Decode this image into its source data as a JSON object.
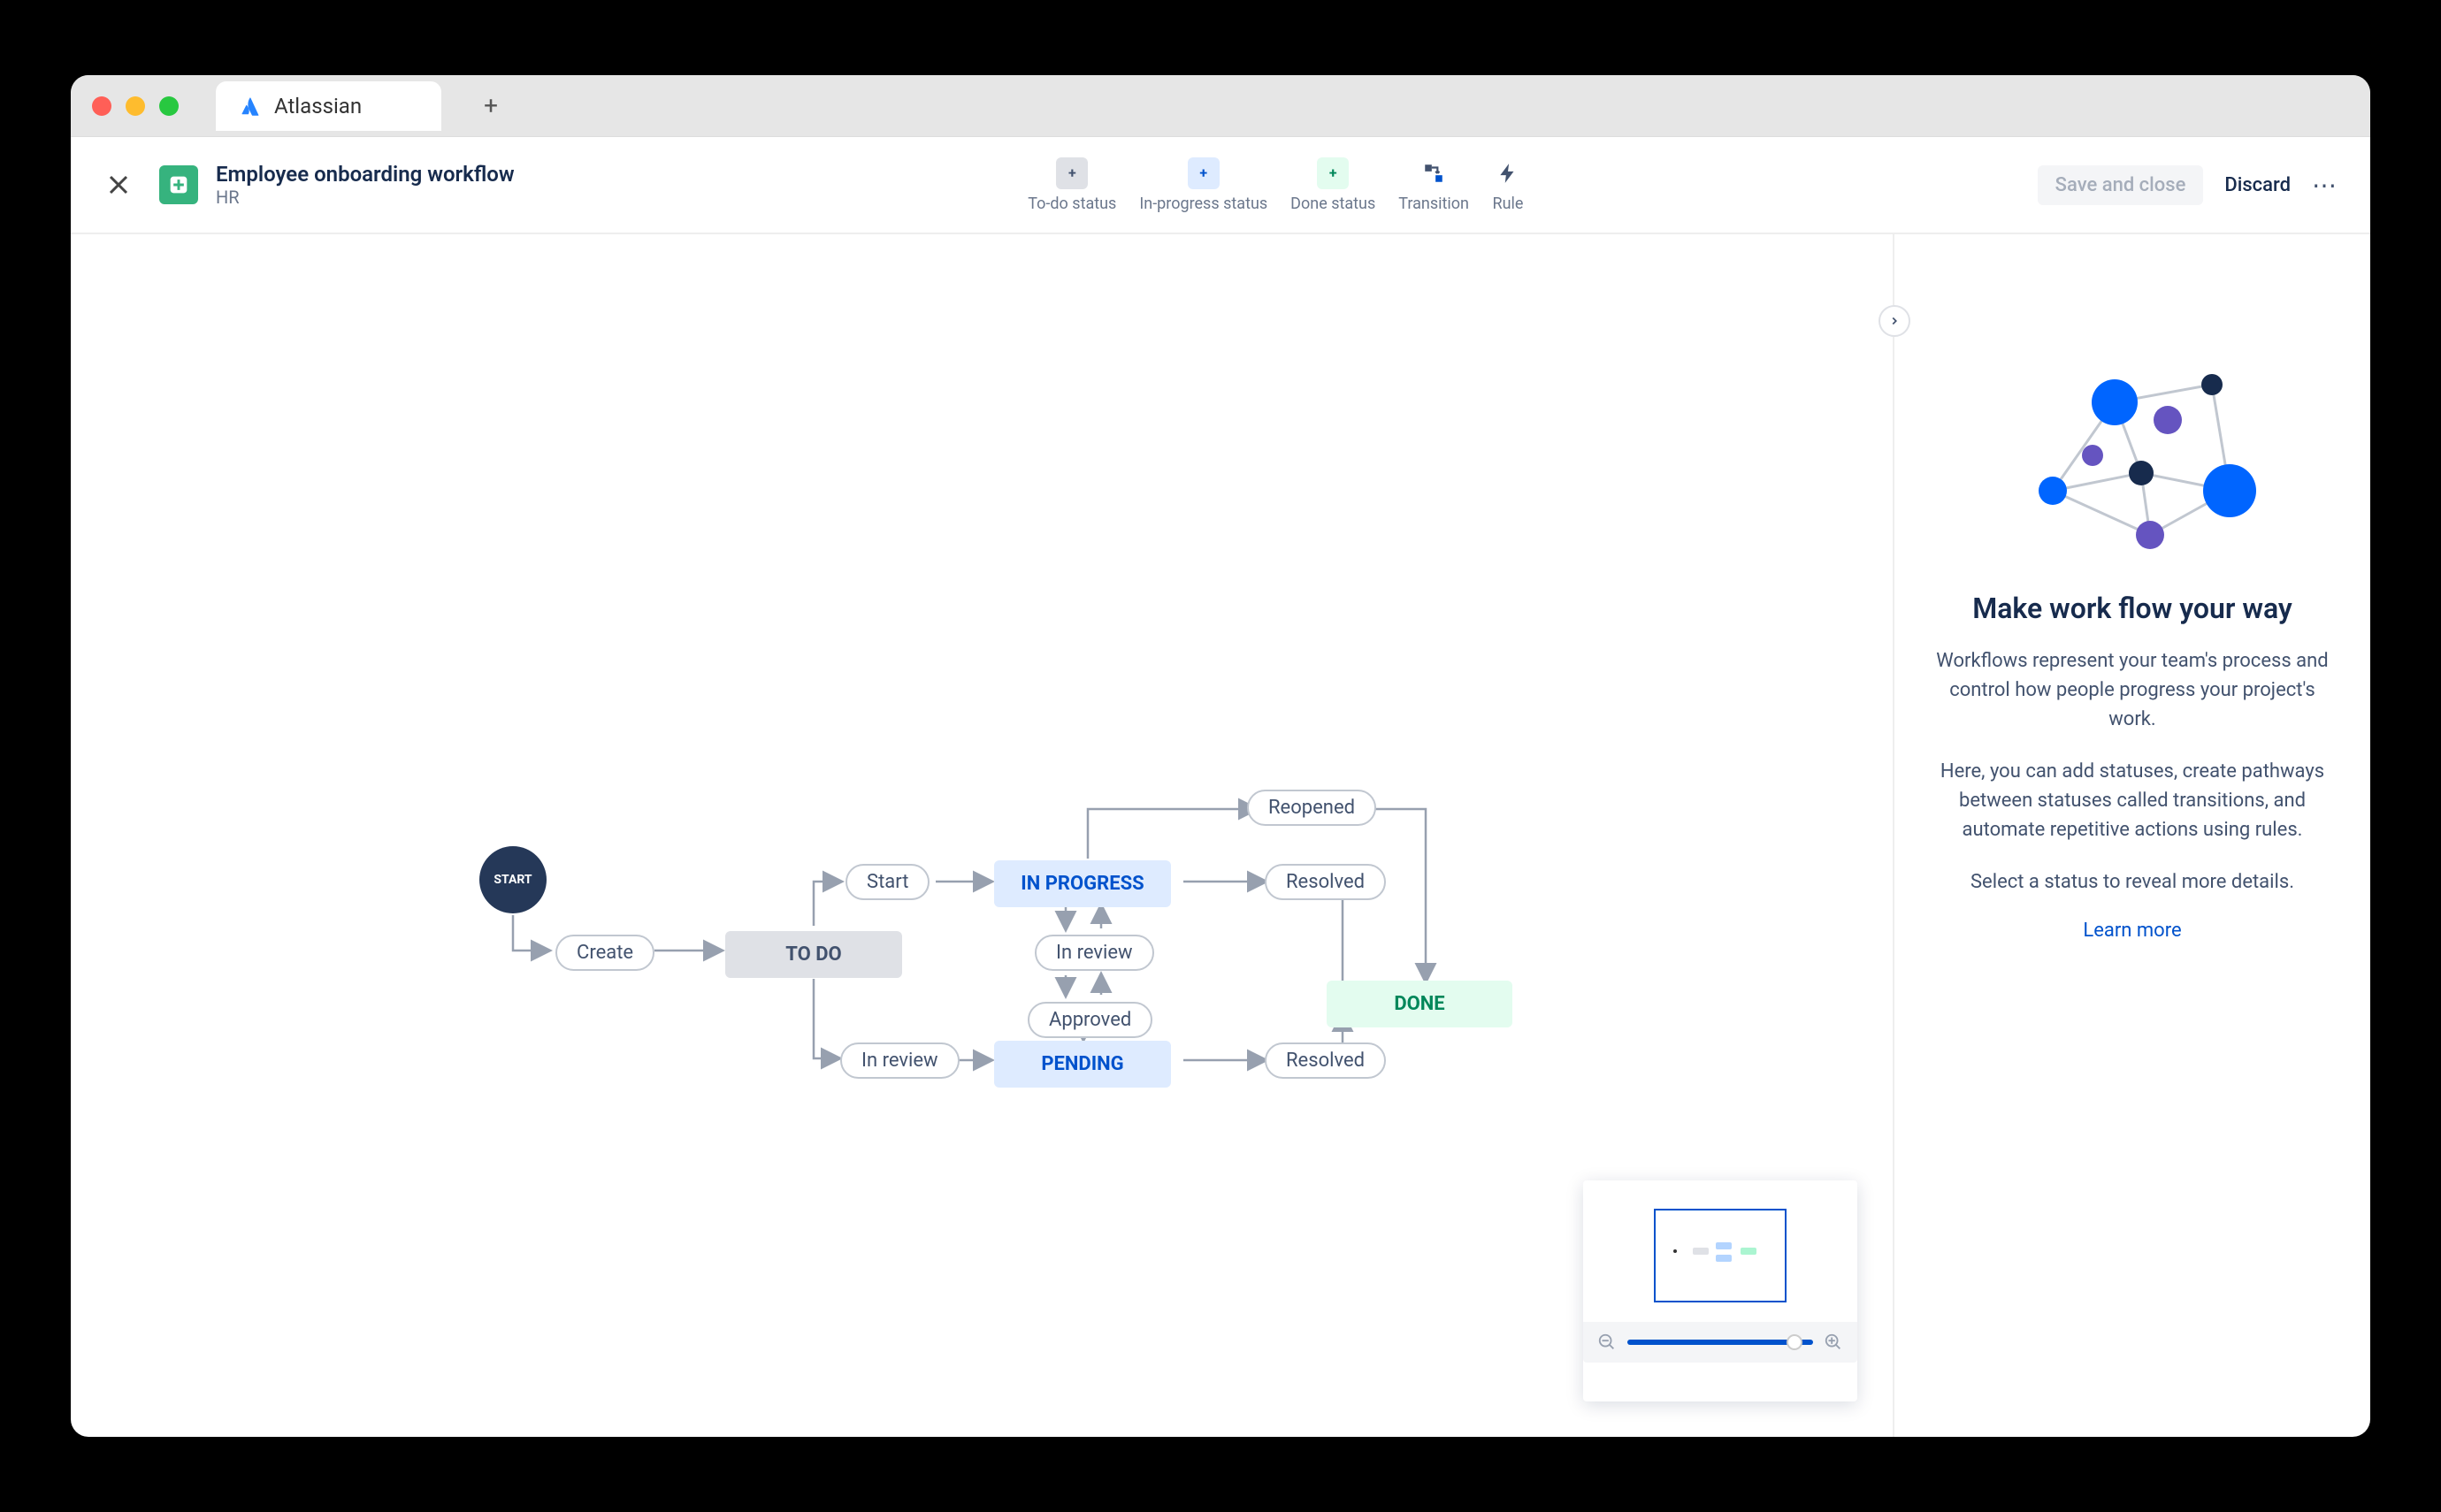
{
  "tab": {
    "label": "Atlassian"
  },
  "header": {
    "title": "Employee onboarding workflow",
    "project": "HR"
  },
  "tools": {
    "todo": "To-do status",
    "inprogress": "In-progress status",
    "done": "Done status",
    "transition": "Transition",
    "rule": "Rule"
  },
  "actions": {
    "save": "Save and close",
    "discard": "Discard"
  },
  "diagram": {
    "start": "START",
    "statuses": {
      "todo": "TO DO",
      "inprogress": "IN PROGRESS",
      "pending": "PENDING",
      "done": "DONE"
    },
    "transitions": {
      "create": "Create",
      "start": "Start",
      "inreview_top": "In review",
      "inreview_left": "In review",
      "approved": "Approved",
      "reopened": "Reopened",
      "resolved1": "Resolved",
      "resolved2": "Resolved"
    }
  },
  "sidebar": {
    "heading": "Make work flow your way",
    "p1": "Workflows represent your team's process and control how people progress your project's work.",
    "p2": "Here, you can add statuses, create pathways between statuses called transitions, and automate repetitive actions using rules.",
    "p3": "Select a status to reveal more details.",
    "learn": "Learn more"
  }
}
